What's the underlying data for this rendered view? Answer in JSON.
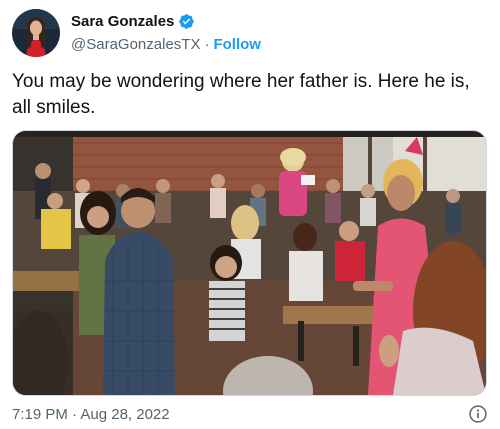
{
  "author": {
    "display_name": "Sara Gonzales",
    "handle": "@SaraGonzalesTX",
    "separator": "·",
    "follow_label": "Follow",
    "verified": true,
    "verified_color": "#1d9bf0"
  },
  "tweet": {
    "text": "You may be wondering where her father is. Here he is, all smiles.",
    "timestamp": "7:19 PM · Aug 28, 2022"
  },
  "colors": {
    "accent": "#1d9bf0",
    "text_primary": "#0f1419",
    "text_secondary": "#536471",
    "border": "#cfd9de"
  },
  "icons": {
    "verified": "verified-badge-icon",
    "info": "info-icon"
  }
}
